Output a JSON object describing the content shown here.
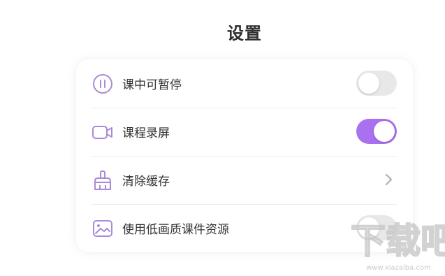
{
  "page": {
    "title": "设置"
  },
  "settings": [
    {
      "label": "课中可暂停",
      "icon": "pause-icon",
      "control": "toggle",
      "enabled": false
    },
    {
      "label": "课程录屏",
      "icon": "video-camera-icon",
      "control": "toggle",
      "enabled": true
    },
    {
      "label": "清除缓存",
      "icon": "broom-icon",
      "control": "chevron"
    },
    {
      "label": "使用低画质课件资源",
      "icon": "image-icon",
      "control": "toggle",
      "enabled": false
    }
  ],
  "colors": {
    "accent": "#a971f0",
    "icon": "#a98bd8",
    "toggle_off": "#e8e8e8",
    "text": "#333333"
  },
  "watermark": {
    "text": "下载吧",
    "url_text": "www.xiazaiba.com"
  }
}
